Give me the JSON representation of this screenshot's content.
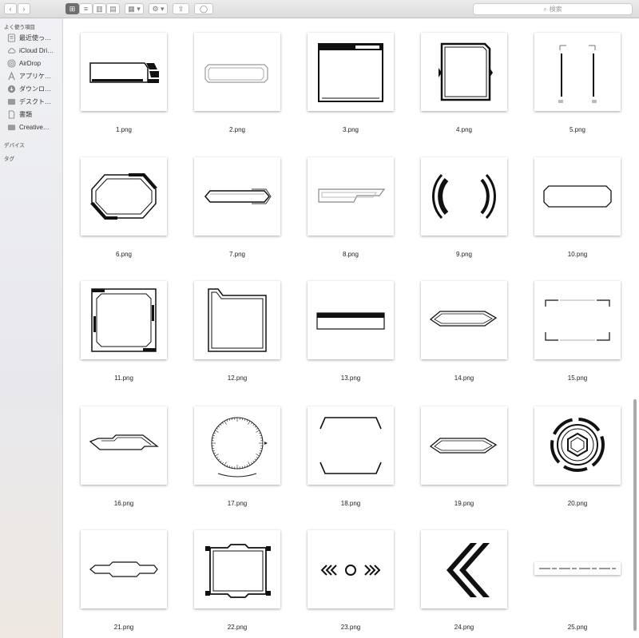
{
  "toolbar": {
    "back_glyph": "‹",
    "forward_glyph": "›",
    "view_icon_glyph": "⊞",
    "list_glyph": "≡",
    "column_glyph": "▥",
    "gallery_glyph": "▤",
    "group_glyph": "▦ ▾",
    "action_glyph": "⚙ ▾",
    "share_glyph": "⇪",
    "tag_glyph": "◯",
    "search_placeholder": "検索",
    "search_icon": "⌕"
  },
  "sidebar": {
    "favorites_header": "よく使う項目",
    "items": [
      {
        "label": "最近使っ…",
        "icon": "recents-icon"
      },
      {
        "label": "iCloud Dri…",
        "icon": "cloud-icon"
      },
      {
        "label": "AirDrop",
        "icon": "airdrop-icon"
      },
      {
        "label": "アプリケ…",
        "icon": "applications-icon"
      },
      {
        "label": "ダウンロ…",
        "icon": "downloads-icon"
      },
      {
        "label": "デスクト…",
        "icon": "desktop-folder-icon"
      },
      {
        "label": "書類",
        "icon": "documents-icon"
      },
      {
        "label": "Creative…",
        "icon": "folder-icon"
      }
    ],
    "devices_header": "デバイス",
    "tags_header": "タグ"
  },
  "files": [
    {
      "name": "1.png"
    },
    {
      "name": "2.png"
    },
    {
      "name": "3.png"
    },
    {
      "name": "4.png"
    },
    {
      "name": "5.png"
    },
    {
      "name": "6.png"
    },
    {
      "name": "7.png"
    },
    {
      "name": "8.png"
    },
    {
      "name": "9.png"
    },
    {
      "name": "10.png"
    },
    {
      "name": "11.png"
    },
    {
      "name": "12.png"
    },
    {
      "name": "13.png"
    },
    {
      "name": "14.png"
    },
    {
      "name": "15.png"
    },
    {
      "name": "16.png"
    },
    {
      "name": "17.png"
    },
    {
      "name": "18.png"
    },
    {
      "name": "19.png"
    },
    {
      "name": "20.png"
    },
    {
      "name": "21.png"
    },
    {
      "name": "22.png"
    },
    {
      "name": "23.png"
    },
    {
      "name": "24.png"
    },
    {
      "name": "25.png"
    }
  ],
  "colors": {
    "toolbar_bg": "#e3e3e3",
    "sidebar_bg": "#eceef2",
    "active_button": "#6e6e6e",
    "frame_ink": "#111111"
  }
}
